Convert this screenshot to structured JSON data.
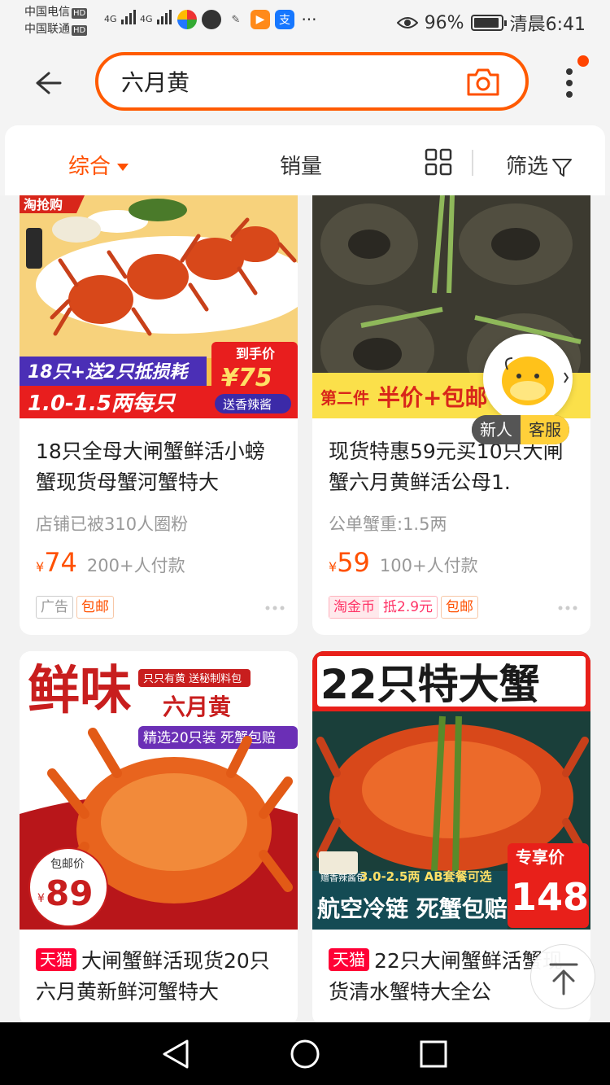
{
  "status_bar": {
    "carrier1": "中国电信",
    "carrier2": "中国联通",
    "hd": "HD",
    "net1": "4G",
    "net2": "4G",
    "battery": "96%",
    "time": "清晨6:41",
    "more": "···"
  },
  "search": {
    "query": "六月黄"
  },
  "filters": {
    "comprehensive": "综合",
    "sales": "销量",
    "filter": "筛选"
  },
  "products": [
    {
      "title": "18只全母大闸蟹鲜活小螃蟹现货母蟹河蟹特大",
      "subtitle": "店铺已被310人圈粉",
      "currency": "¥",
      "price": "74",
      "payers": "200+人付款",
      "tags": [
        "广告",
        "包邮"
      ],
      "banner": {
        "corner": "淘抢购",
        "line1": "18只+送2只抵损耗",
        "line2": "1.0-1.5两每只",
        "price_label": "到手价",
        "price": "¥75",
        "gift": "送香辣酱"
      }
    },
    {
      "title": "现货特惠59元买10只大闸蟹六月黄鲜活公母1.",
      "subtitle": "公单蟹重:1.5两",
      "currency": "¥",
      "price": "59",
      "payers": "100+人付款",
      "coin_tag_left": "淘金币",
      "coin_tag_right": "抵2.9元",
      "tags": [
        "包邮"
      ],
      "banner": {
        "line1": "第二件",
        "line2": "半价+包邮"
      }
    },
    {
      "store_badge": "天猫",
      "title": "大闸蟹鲜活现货20只六月黄新鲜河蟹特大",
      "banner": {
        "big": "鲜味",
        "ribbon": "只只有黄 送秘制料包",
        "name": "六月黄",
        "line": "精选20只装 死蟹包赔",
        "price_label": "包邮价",
        "price": "89",
        "currency": "¥"
      }
    },
    {
      "store_badge": "天猫",
      "title": "22只大闸蟹鲜活蟹现货清水蟹特大全公",
      "banner": {
        "headline": "22只特大蟹",
        "small": "赠香辣酱包",
        "sizes": "3.0-2.5两 AB套餐可选",
        "bottom": "航空冷链 死蟹包赔",
        "price_label": "专享价",
        "price": "148"
      }
    }
  ],
  "customer_service": {
    "new": "新人",
    "service": "客服"
  },
  "colors": {
    "accent": "#ff5000",
    "tmall": "#ff0036"
  }
}
